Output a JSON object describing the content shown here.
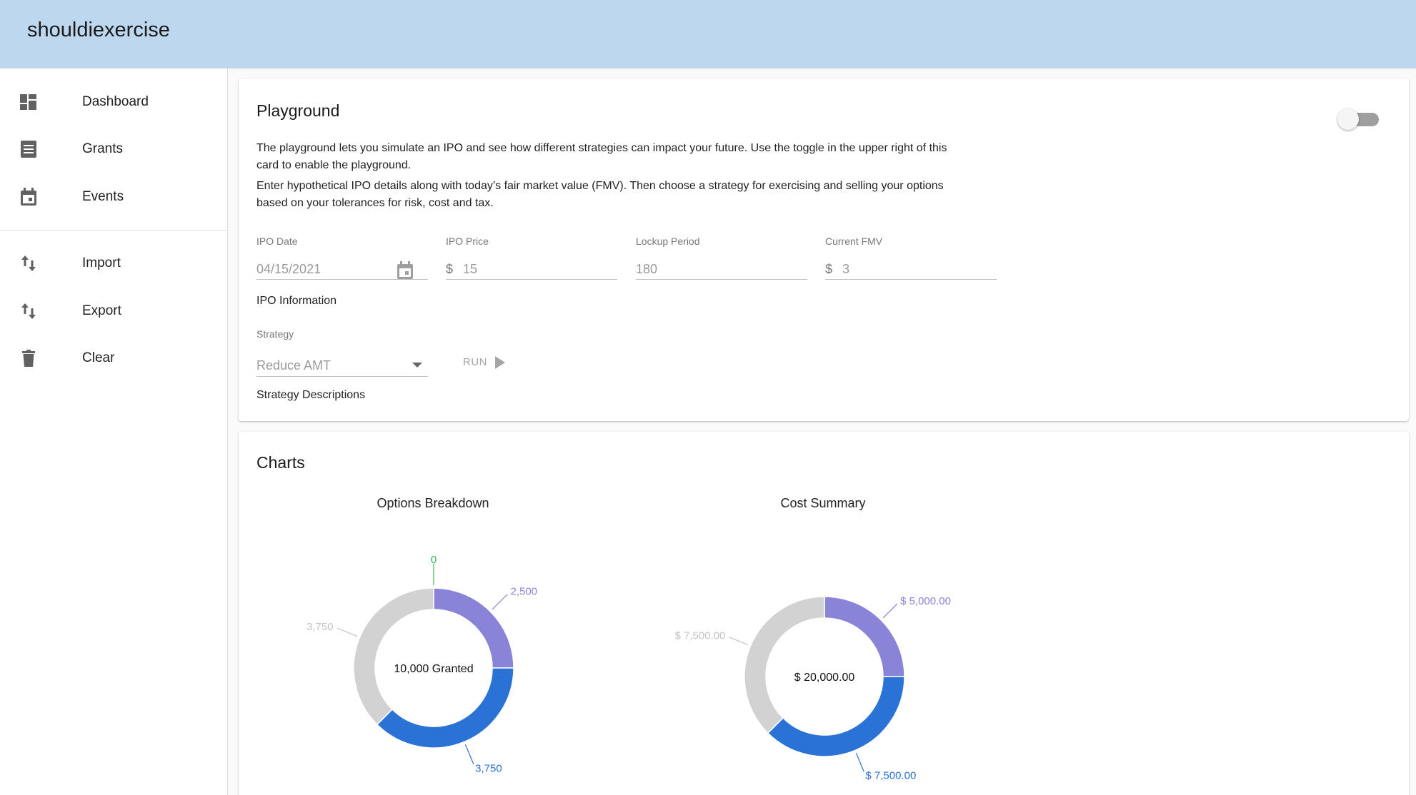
{
  "app": {
    "title": "shouldiexercise"
  },
  "sidebar": {
    "items": [
      {
        "label": "Dashboard",
        "icon": "dashboard-icon"
      },
      {
        "label": "Grants",
        "icon": "list-alt-icon"
      },
      {
        "label": "Events",
        "icon": "calendar-icon"
      },
      {
        "label": "Import",
        "icon": "swap-vertical-icon"
      },
      {
        "label": "Export",
        "icon": "swap-vertical-icon"
      },
      {
        "label": "Clear",
        "icon": "trash-icon"
      }
    ]
  },
  "playground": {
    "title": "Playground",
    "enabled": false,
    "paragraph1": "The playground lets you simulate an IPO and see how different strategies can impact your future. Use the toggle in the upper right of this card to enable the playground.",
    "paragraph2": "Enter hypothetical IPO details along with today’s fair market value (FMV). Then choose a strategy for exercising and selling your options based on your tolerances for risk, cost and tax.",
    "fields": {
      "ipo_date": {
        "label": "IPO Date",
        "value": "04/15/2021"
      },
      "ipo_price": {
        "label": "IPO Price",
        "prefix": "$",
        "value": "15"
      },
      "lockup": {
        "label": "Lockup Period",
        "value": "180"
      },
      "fmv": {
        "label": "Current FMV",
        "prefix": "$",
        "value": "3"
      }
    },
    "ipo_info_link": "IPO Information",
    "strategy": {
      "label": "Strategy",
      "value": "Reduce AMT"
    },
    "run_label": "RUN",
    "strategy_link": "Strategy Descriptions"
  },
  "charts": {
    "title": "Charts",
    "colors": {
      "purple": "#8a84d8",
      "blue": "#2a72d5",
      "gray": "#d2d2d2",
      "green": "#3bb34a"
    }
  },
  "chart_data": [
    {
      "type": "pie",
      "title": "Options Breakdown",
      "center_label": "10,000 Granted",
      "slices": [
        {
          "value": 0,
          "label": "0",
          "color": "#3bb34a"
        },
        {
          "value": 2500,
          "label": "2,500",
          "color": "#8a84d8"
        },
        {
          "value": 3750,
          "label": "3,750",
          "color": "#2a72d5"
        },
        {
          "value": 3750,
          "label": "3,750",
          "color": "#d2d2d2"
        }
      ]
    },
    {
      "type": "pie",
      "title": "Cost Summary",
      "center_label": "$ 20,000.00",
      "slices": [
        {
          "value": 5000,
          "label": "$ 5,000.00",
          "color": "#8a84d8"
        },
        {
          "value": 7500,
          "label": "$ 7,500.00",
          "color": "#2a72d5"
        },
        {
          "value": 7500,
          "label": "$ 7,500.00",
          "color": "#d2d2d2"
        }
      ]
    }
  ]
}
